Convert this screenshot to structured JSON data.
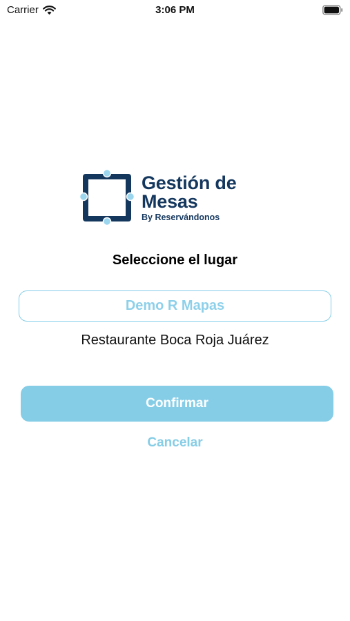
{
  "status_bar": {
    "carrier": "Carrier",
    "time": "3:06 PM"
  },
  "logo": {
    "line1": "Gestión de",
    "line2": "Mesas",
    "subtitle": "By Reservándonos"
  },
  "prompt": "Seleccione el lugar",
  "places": {
    "selected": "Demo R Mapas",
    "options": [
      "Restaurante Boca Roja Juárez"
    ]
  },
  "actions": {
    "confirm": "Confirmar",
    "cancel": "Cancelar"
  },
  "colors": {
    "brand_navy": "#14375e",
    "accent_light_blue": "#85cde7",
    "text_dark": "#000000",
    "background": "#ffffff"
  },
  "icons": {
    "wifi": "wifi-icon",
    "battery": "battery-icon",
    "logo": "table-frame-logo-icon"
  }
}
